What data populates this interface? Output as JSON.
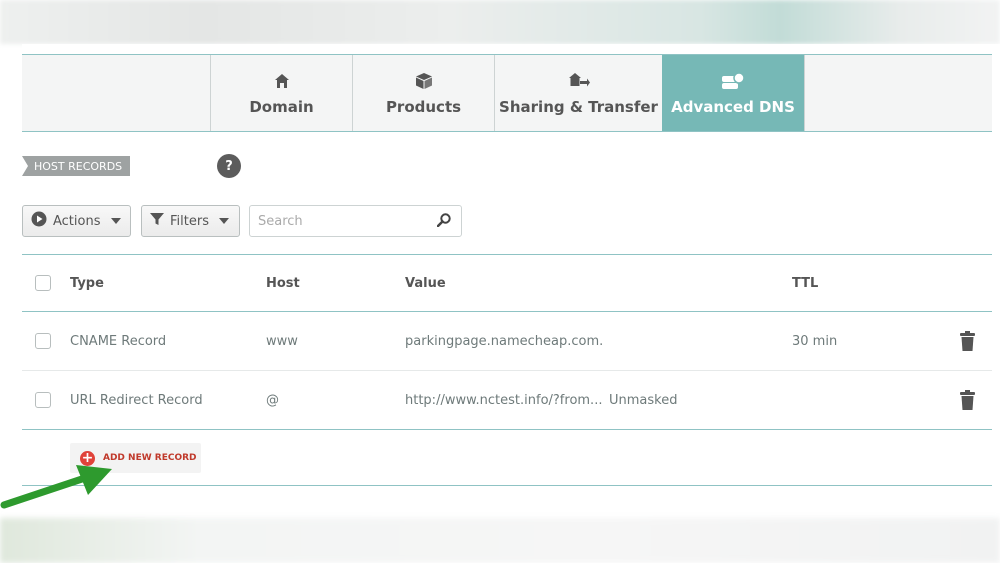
{
  "tabs": [
    {
      "label": "Domain",
      "icon": "home-icon",
      "active": false
    },
    {
      "label": "Products",
      "icon": "box-icon",
      "active": false
    },
    {
      "label": "Sharing & Transfer",
      "icon": "share-icon",
      "active": false
    },
    {
      "label": "Advanced DNS",
      "icon": "dns-icon",
      "active": true
    }
  ],
  "section": {
    "title": "HOST RECORDS",
    "help": "?"
  },
  "toolbar": {
    "actions_label": "Actions",
    "filters_label": "Filters",
    "search_placeholder": "Search"
  },
  "table": {
    "columns": [
      "Type",
      "Host",
      "Value",
      "TTL"
    ],
    "rows": [
      {
        "type": "CNAME Record",
        "host": "www",
        "value": "parkingpage.namecheap.com.",
        "extra": "",
        "ttl": "30 min"
      },
      {
        "type": "URL Redirect Record",
        "host": "@",
        "value": "http://www.nctest.info/?from...",
        "extra": "Unmasked",
        "ttl": ""
      }
    ]
  },
  "add_record_label": "ADD NEW RECORD",
  "colors": {
    "accent": "#76b8b6",
    "add": "#e0433a",
    "arrow": "#2e9a2e"
  }
}
